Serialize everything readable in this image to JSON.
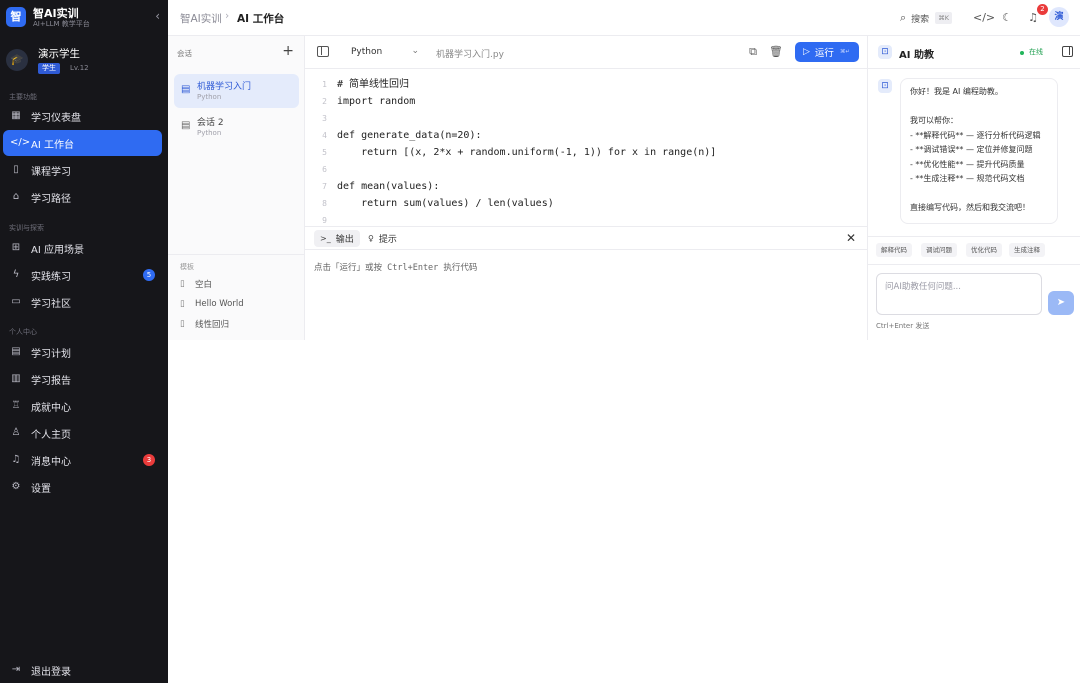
{
  "brand": {
    "logo": "智",
    "name": "智AI实训",
    "subtitle": "AI+LLM 教学平台"
  },
  "user": {
    "name": "演示学生",
    "role": "学生",
    "level": "Lv.12",
    "avatar": "演"
  },
  "sidebar": {
    "sections": [
      {
        "title": "主要功能",
        "items": [
          {
            "label": "学习仪表盘",
            "icon": "dashboard-icon"
          },
          {
            "label": "AI 工作台",
            "icon": "code-icon",
            "active": true
          },
          {
            "label": "课程学习",
            "icon": "book-icon"
          },
          {
            "label": "学习路径",
            "icon": "path-icon"
          }
        ]
      },
      {
        "title": "实训与探索",
        "items": [
          {
            "label": "AI 应用场景",
            "icon": "chip-icon"
          },
          {
            "label": "实践练习",
            "icon": "bolt-icon",
            "badge": "5",
            "badge_color": "#2f6bf2"
          },
          {
            "label": "学习社区",
            "icon": "chat-icon"
          }
        ]
      },
      {
        "title": "个人中心",
        "items": [
          {
            "label": "学习计划",
            "icon": "calendar-icon"
          },
          {
            "label": "学习报告",
            "icon": "bar-chart-icon"
          },
          {
            "label": "成就中心",
            "icon": "trophy-icon"
          },
          {
            "label": "个人主页",
            "icon": "user-icon"
          },
          {
            "label": "消息中心",
            "icon": "bell-icon",
            "badge": "3",
            "badge_color": "#ea3b3b"
          },
          {
            "label": "设置",
            "icon": "gear-icon"
          }
        ]
      }
    ],
    "logout": "退出登录"
  },
  "topbar": {
    "breadcrumb": [
      "智AI实训",
      "AI 工作台"
    ],
    "search_label": "搜索",
    "search_kbd": "⌘K",
    "notification_count": "2",
    "avatar": "演"
  },
  "sessions": {
    "title": "会话",
    "items": [
      {
        "name": "机器学习入门",
        "lang": "Python",
        "active": true
      },
      {
        "name": "会话 2",
        "lang": "Python"
      }
    ],
    "templates_title": "模板",
    "templates": [
      "空白",
      "Hello World",
      "线性回归"
    ]
  },
  "editor": {
    "language": "Python",
    "filename": "机器学习入门.py",
    "run_label": "运行",
    "run_kbd": "⌘↵",
    "code_lines": [
      "# 简单线性回归",
      "import random",
      "",
      "def generate_data(n=20):",
      "    return [(x, 2*x + random.uniform(-1, 1)) for x in range(n)]",
      "",
      "def mean(values):",
      "    return sum(values) / len(values)",
      ""
    ],
    "output_tabs": [
      "输出",
      "提示"
    ],
    "output_hint": "点击「运行」或按 Ctrl+Enter 执行代码"
  },
  "assistant": {
    "title": "AI 助教",
    "status": "在线",
    "message_lines": [
      "你好！我是 AI 编程助教。",
      "",
      "我可以帮你：",
      "- **解释代码** — 逐行分析代码逻辑",
      "- **调试错误** — 定位并修复问题",
      "- **优化性能** — 提升代码质量",
      "- **生成注释** — 规范代码文档",
      "",
      "直接编写代码，然后和我交流吧！"
    ],
    "quick_actions": [
      "解释代码",
      "调试问题",
      "优化代码",
      "生成注释"
    ],
    "input_placeholder": "问AI助教任何问题...",
    "send_hint": "Ctrl+Enter 发送"
  },
  "colors": {
    "accent": "#2f6bf2",
    "sidebar_bg": "#16161a",
    "danger": "#ea3b3b",
    "online": "#22b55b"
  }
}
